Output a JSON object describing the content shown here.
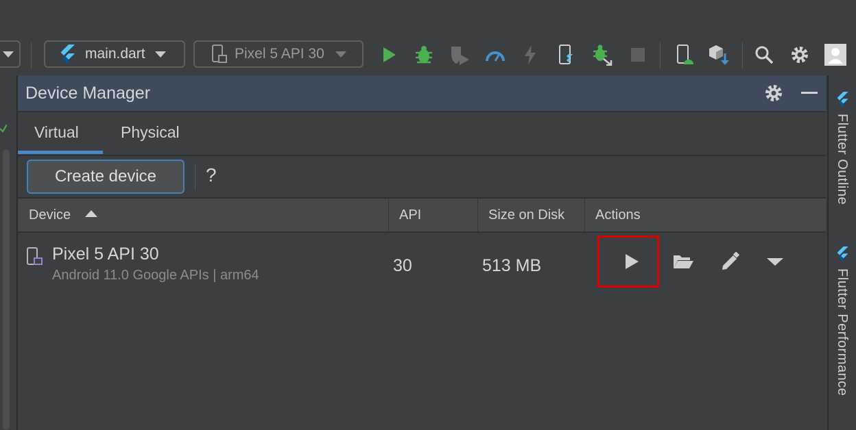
{
  "toolbar": {
    "config_combo": {
      "label": "main.dart",
      "icon": "flutter-icon"
    },
    "device_combo": {
      "label": "Pixel 5 API 30",
      "icon": "phone-icon"
    },
    "icons": [
      "run-icon",
      "debug-icon",
      "coverage-icon",
      "profile-icon",
      "hot-reload-icon",
      "device-mirror-icon",
      "attach-debugger-icon",
      "stop-icon",
      "device-manager-icon",
      "sdk-manager-icon",
      "search-icon",
      "settings-icon",
      "user-icon"
    ]
  },
  "colors": {
    "accent": "#4a88c7",
    "run_green": "#4caf50",
    "highlight_red": "#e10000",
    "panel_header": "#3d4b5c"
  },
  "panel": {
    "title": "Device Manager",
    "tabs": [
      {
        "label": "Virtual",
        "selected": true
      },
      {
        "label": "Physical",
        "selected": false
      }
    ],
    "create_device_label": "Create device",
    "help_label": "?",
    "table": {
      "columns": [
        "Device",
        "API",
        "Size on Disk",
        "Actions"
      ],
      "sort": "Device ascending",
      "rows": [
        {
          "name": "Pixel 5 API 30",
          "subtitle": "Android 11.0 Google APIs | arm64",
          "api": "30",
          "size": "513 MB",
          "actions": [
            "launch-icon",
            "folder-open-icon",
            "edit-icon",
            "dropdown-icon"
          ]
        }
      ]
    }
  },
  "side_panels": {
    "flutter_outline": "Flutter Outline",
    "flutter_performance": "Flutter Performance"
  }
}
